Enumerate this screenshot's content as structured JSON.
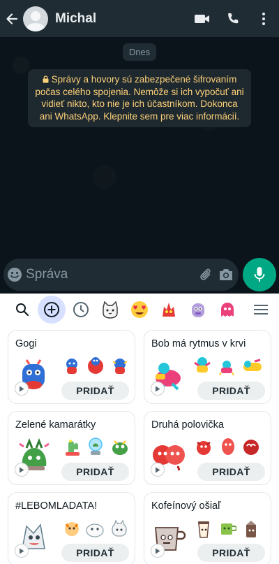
{
  "header": {
    "contact_name": "Michal",
    "icons": [
      "back-arrow-icon",
      "avatar",
      "video-call-icon",
      "phone-icon",
      "more-options-icon"
    ]
  },
  "chat": {
    "date_chip": "Dnes",
    "encryption_notice": "Správy a hovory sú zabezpečené šifrovaním počas celého spojenia. Nemôže si ich vypočuť ani vidieť nikto, kto nie je ich účastníkom. Dokonca ani WhatsApp. Klepnite sem pre viac informácií."
  },
  "compose": {
    "placeholder": "Správa",
    "icons": [
      "emoji-icon",
      "attach-icon",
      "camera-icon",
      "mic-icon"
    ]
  },
  "sticker_toolbar": {
    "tabs": [
      "search-icon",
      "add-stickers-icon",
      "recent-icon",
      "sticker-pack-cat",
      "sticker-pack-heart-eyes",
      "sticker-pack-red-beast",
      "sticker-pack-purple-friend",
      "sticker-pack-pink-ghost",
      "menu-icon"
    ],
    "active_tab": "add-stickers-icon"
  },
  "sticker_packs": [
    {
      "title": "Gogi",
      "button": "PRIDAŤ"
    },
    {
      "title": "Bob má rytmus v krvi",
      "button": "PRIDAŤ"
    },
    {
      "title": "Zelené kamarátky",
      "button": "PRIDAŤ"
    },
    {
      "title": "Druhá polovička",
      "button": "PRIDAŤ"
    },
    {
      "title": "#LEBOMLADATA!",
      "button": "PRIDAŤ"
    },
    {
      "title": "Kofeínový ošiaľ",
      "button": "PRIDAŤ"
    }
  ],
  "colors": {
    "header_bg": "#1f2c34",
    "chat_bg": "#0b141a",
    "notice_text": "#ffd279",
    "accent_green": "#00a884",
    "active_tab_bg": "#d7e0ff"
  }
}
